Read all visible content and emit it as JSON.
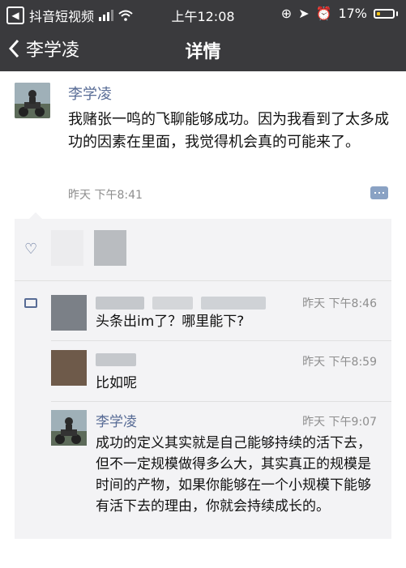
{
  "status_bar": {
    "app_label": "抖音短视频",
    "time": "上午12:08",
    "battery": "17%",
    "battery_level": 0.17
  },
  "nav": {
    "back_label": "李学凌",
    "title": "详情"
  },
  "post": {
    "author": "李学凌",
    "text": "我赌张一鸣的飞聊能够成功。因为我看到了太多成功的因素在里面，我觉得机会真的可能来了。",
    "timestamp": "昨天  下午8:41"
  },
  "comments": [
    {
      "time": "昨天  下午8:46",
      "text": "头条出im了？哪里能下?"
    },
    {
      "time": "昨天  下午8:59",
      "text": "比如呢"
    },
    {
      "author": "李学凌",
      "time": "昨天  下午9:07",
      "text": "成功的定义其实就是自己能够持续的活下去，但不一定规模做得多么大，其实真正的规模是时间的产物，如果你能够在一个小规模下能够有活下去的理由，你就会持续成长的。"
    }
  ],
  "icons": {
    "back": "chevron-left-icon",
    "like": "heart-icon",
    "comment": "comment-icon",
    "more": "more-icon"
  }
}
